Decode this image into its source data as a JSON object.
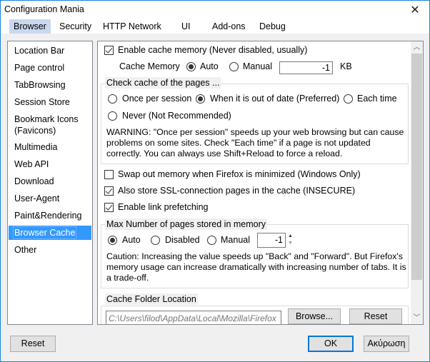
{
  "window": {
    "title": "Configuration Mania",
    "close_icon": "close-icon"
  },
  "menu": {
    "items": [
      "Browser",
      "Security",
      "HTTP Network",
      "UI",
      "Add-ons",
      "Debug"
    ],
    "active": "Browser"
  },
  "sidebar": {
    "items": [
      "Location Bar",
      "Page control",
      "TabBrowsing",
      "Session Store",
      "Bookmark Icons\n(Favicons)",
      "Multimedia",
      "Web API",
      "Download",
      "User-Agent",
      "Paint&Rendering",
      "Browser Cache",
      "Other"
    ],
    "selected": "Browser Cache",
    "bookmark_line1": "Bookmark Icons",
    "bookmark_line2": "(Favicons)"
  },
  "cache": {
    "enable_cache_memory": {
      "label": "Enable cache memory (Never disabled, usually)",
      "checked": true
    },
    "cache_memory_label": "Cache Memory",
    "cache_memory_auto": {
      "label": "Auto",
      "checked": true
    },
    "cache_memory_manual": {
      "label": "Manual",
      "checked": false
    },
    "cache_memory_value": "-1",
    "cache_memory_unit": "KB",
    "check_group": {
      "title": "Check cache of the pages ...",
      "options": [
        {
          "label": "Once per session",
          "checked": false
        },
        {
          "label": "When it is out of date (Preferred)",
          "checked": true
        },
        {
          "label": "Each time",
          "checked": false
        },
        {
          "label": "Never (Not Recommended)",
          "checked": false
        }
      ],
      "warning": "WARNING: \"Once per session\" speeds up your web browsing but can cause problems on some sites. Check \"Each time\" if a page is not updated correctly. You can always use Shift+Reload to force a reload."
    },
    "swap_out": {
      "label": "Swap out memory when Firefox is minimized (Windows Only)",
      "checked": false
    },
    "ssl_cache": {
      "label": "Also store SSL-connection pages in the cache (INSECURE)",
      "checked": true
    },
    "link_prefetch": {
      "label": "Enable link prefetching",
      "checked": true
    },
    "max_pages_group": {
      "title": "Max Number of pages stored in memory",
      "options": [
        {
          "label": "Auto",
          "checked": true
        },
        {
          "label": "Disabled",
          "checked": false
        },
        {
          "label": "Manual",
          "checked": false
        }
      ],
      "value": "-1",
      "caution": "Caution: Increasing the value speeds up \"Back\" and \"Forward\". But Firefox's memory usage can increase dramatically with increasing number of tabs. It is a trade-off."
    },
    "folder_group": {
      "title": "Cache Folder Location",
      "path_placeholder": "C:\\Users\\filod\\AppData\\Local\\Mozilla\\Firefox",
      "browse_label": "Browse...",
      "reset_label": "Reset"
    }
  },
  "footer": {
    "reset_label": "Reset",
    "ok_label": "OK",
    "cancel_label": "Ακύρωση"
  },
  "colors": {
    "accent": "#0078d7",
    "selection": "#3399ff",
    "active_tab": "#c8d8ee"
  }
}
